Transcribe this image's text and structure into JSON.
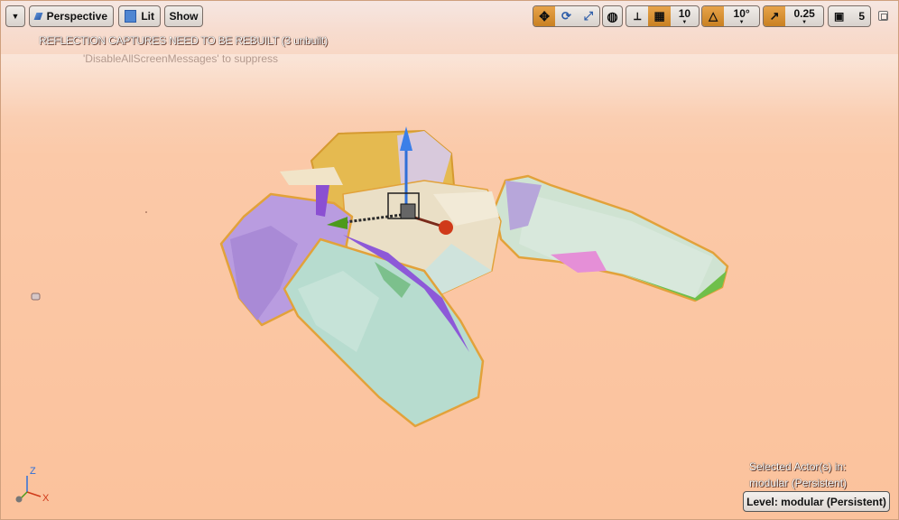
{
  "toolbar": {
    "perspective_label": "Perspective",
    "lit_label": "Lit",
    "show_label": "Show",
    "grid_snap_value": "10",
    "rotation_snap_value": "10°",
    "scale_snap_value": "0.25",
    "camera_speed_value": "5"
  },
  "messages": {
    "warning": "REFLECTION CAPTURES NEED TO BE REBUILT (3 unbuilt)",
    "hint": "'DisableAllScreenMessages' to suppress"
  },
  "status": {
    "selected_line1": "Selected Actor(s) in:",
    "selected_line2": "modular (Persistent)",
    "level_label": "Level:  modular (Persistent)"
  },
  "axis_indicator": {
    "z": "Z",
    "x": "X"
  },
  "colors": {
    "accent_orange": "#d98e2a",
    "gizmo_z": "#2f6fd8",
    "gizmo_x": "#d03a1a",
    "gizmo_y": "#4c9a1c",
    "sky": "#fbc6a3"
  }
}
